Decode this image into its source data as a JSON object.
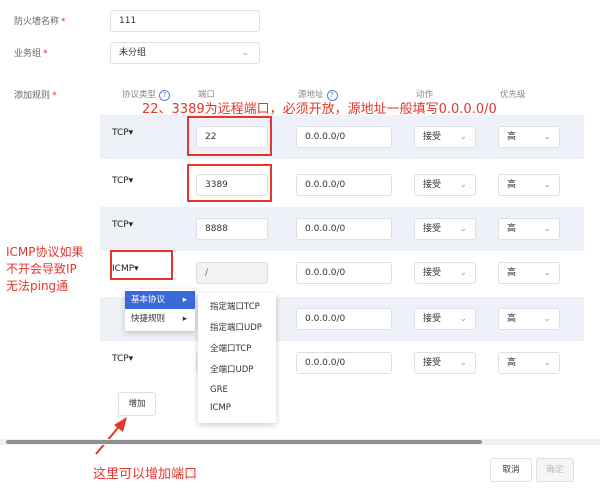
{
  "form": {
    "name_label": "防火墙名称",
    "name_value": "111",
    "group_label": "业务组",
    "group_value": "未分组",
    "rules_label": "添加规则",
    "required_mark": "*"
  },
  "headers": {
    "protocol": "协议类型",
    "port": "端口",
    "source": "源地址",
    "action": "动作",
    "priority": "优先级"
  },
  "rules": [
    {
      "protocol": "TCP▾",
      "port": "22",
      "source": "0.0.0.0/0",
      "action": "接受",
      "priority": "高"
    },
    {
      "protocol": "TCP▾",
      "port": "3389",
      "source": "0.0.0.0/0",
      "action": "接受",
      "priority": "高"
    },
    {
      "protocol": "TCP▾",
      "port": "8888",
      "source": "0.0.0.0/0",
      "action": "接受",
      "priority": "高"
    },
    {
      "protocol": "ICMP▾",
      "port": "/",
      "source": "0.0.0.0/0",
      "action": "接受",
      "priority": "高"
    },
    {
      "protocol": "",
      "port": "",
      "source": "0.0.0.0/0",
      "action": "接受",
      "priority": "高"
    },
    {
      "protocol": "TCP▾",
      "port": "",
      "source": "0.0.0.0/0",
      "action": "接受",
      "priority": "高"
    }
  ],
  "protocol_menu": {
    "items": [
      "基本协议",
      "快捷规则"
    ],
    "arrow": "▸",
    "sub_items": [
      "指定端口TCP",
      "指定端口UDP",
      "全端口TCP",
      "全端口UDP",
      "GRE",
      "ICMP"
    ]
  },
  "add_button": "增加",
  "cancel_button": "取消",
  "confirm_button": "确定",
  "annotations": {
    "top": "22、3389为远程端口，必须开放，源地址一般填写0.0.0.0/0",
    "left_1": "ICMP协议如果",
    "left_2": "不开会导致IP",
    "left_3": "无法ping通",
    "bottom": "这里可以增加端口"
  },
  "colors": {
    "annotation": "#e8352b",
    "menu_active": "#3b6ad8",
    "row_shade": "#eff1f8"
  },
  "icons": {
    "help": "question-circle-icon",
    "dropdown": "chevron-down-icon"
  }
}
